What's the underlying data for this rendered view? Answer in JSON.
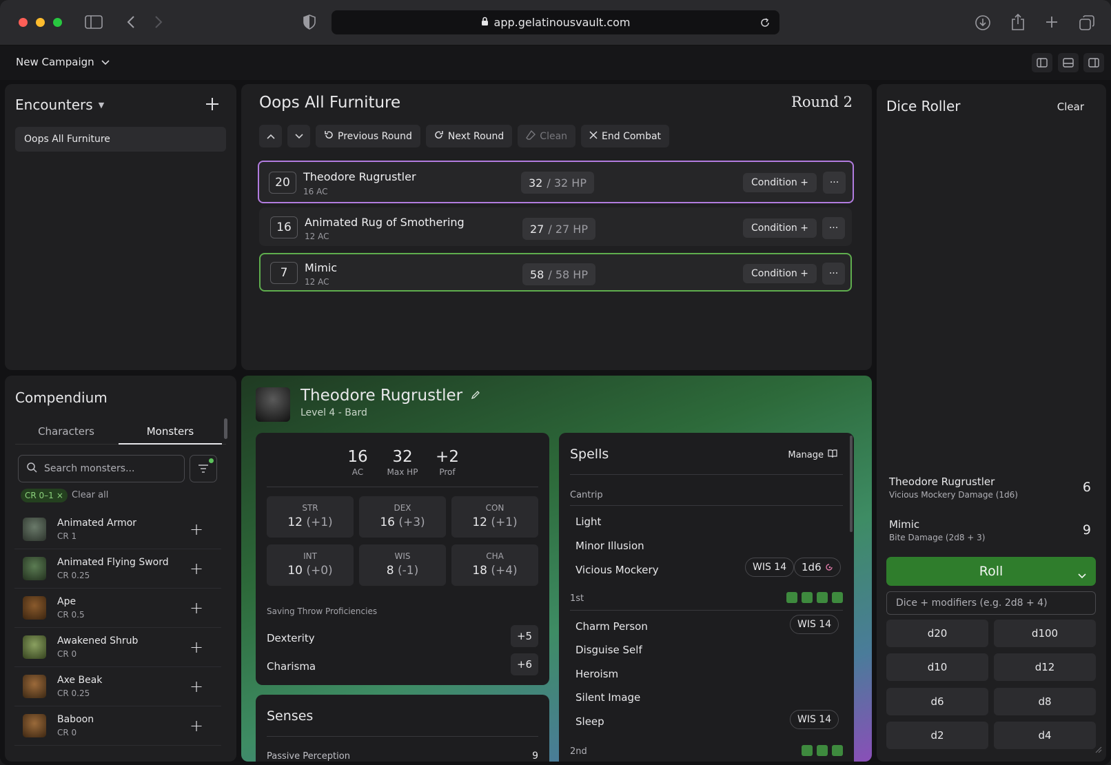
{
  "browser": {
    "url": "app.gelatinousvault.com"
  },
  "app": {
    "campaign": "New Campaign"
  },
  "encounters": {
    "title": "Encounters",
    "items": [
      "Oops All Furniture"
    ]
  },
  "tracker": {
    "title": "Oops All Furniture",
    "round": "Round 2",
    "buttons": {
      "prev": "Previous Round",
      "next": "Next Round",
      "clean": "Clean",
      "end": "End Combat"
    },
    "rows": [
      {
        "init": "20",
        "name": "Theodore Rugrustler",
        "ac": "16 AC",
        "hp_cur": "32",
        "hp_max": "/ 32 HP",
        "cond": "Condition +",
        "more": "···"
      },
      {
        "init": "16",
        "name": "Animated Rug of Smothering",
        "ac": "12 AC",
        "hp_cur": "27",
        "hp_max": "/ 27 HP",
        "cond": "Condition +",
        "more": "···"
      },
      {
        "init": "7",
        "name": "Mimic",
        "ac": "12 AC",
        "hp_cur": "58",
        "hp_max": "/ 58 HP",
        "cond": "Condition +",
        "more": "···"
      }
    ]
  },
  "compendium": {
    "title": "Compendium",
    "tabs": [
      "Characters",
      "Monsters"
    ],
    "search_placeholder": "Search monsters...",
    "filter_chip": "CR 0–1",
    "clear_all": "Clear all",
    "monsters": [
      {
        "name": "Animated Armor",
        "cr": "CR 1"
      },
      {
        "name": "Animated Flying Sword",
        "cr": "CR 0.25"
      },
      {
        "name": "Ape",
        "cr": "CR 0.5"
      },
      {
        "name": "Awakened Shrub",
        "cr": "CR 0"
      },
      {
        "name": "Axe Beak",
        "cr": "CR 0.25"
      },
      {
        "name": "Baboon",
        "cr": "CR 0"
      }
    ]
  },
  "sheet": {
    "name": "Theodore Rugrustler",
    "subtitle": "Level 4 - Bard",
    "stats": [
      {
        "value": "16",
        "label": "AC"
      },
      {
        "value": "32",
        "label": "Max HP"
      },
      {
        "value": "+2",
        "label": "Prof"
      }
    ],
    "abilities": [
      {
        "name": "STR",
        "score": "12",
        "mod": "(+1)"
      },
      {
        "name": "DEX",
        "score": "16",
        "mod": "(+3)"
      },
      {
        "name": "CON",
        "score": "12",
        "mod": "(+1)"
      },
      {
        "name": "INT",
        "score": "10",
        "mod": "(+0)"
      },
      {
        "name": "WIS",
        "score": "8",
        "mod": "(-1)"
      },
      {
        "name": "CHA",
        "score": "18",
        "mod": "(+4)"
      }
    ],
    "saving_title": "Saving Throw Proficiencies",
    "saves": [
      {
        "name": "Dexterity",
        "value": "+5"
      },
      {
        "name": "Charisma",
        "value": "+6"
      }
    ],
    "senses_title": "Senses",
    "passive_label": "Passive Perception",
    "passive_value": "9",
    "spells": {
      "title": "Spells",
      "manage": "Manage",
      "cantrip_label": "Cantrip",
      "cantrips": [
        "Light",
        "Minor Illusion",
        "Vicious Mockery"
      ],
      "vm_save": "WIS 14",
      "vm_dice": "1d6",
      "first_label": "1st",
      "first": [
        "Charm Person",
        "Disguise Self",
        "Heroism",
        "Silent Image",
        "Sleep"
      ],
      "charm_save": "WIS 14",
      "sleep_save": "WIS 14",
      "second_label": "2nd",
      "slots_first": 4,
      "slots_second": 3
    }
  },
  "dice": {
    "title": "Dice Roller",
    "clear": "Clear",
    "history": [
      {
        "who": "Theodore Rugrustler",
        "what": "Vicious Mockery Damage (1d6)",
        "result": "6"
      },
      {
        "who": "Mimic",
        "what": "Bite Damage (2d8 + 3)",
        "result": "9"
      }
    ],
    "roll": "Roll",
    "input_placeholder": "Dice + modifiers (e.g. 2d8 + 4)",
    "dice": [
      "d20",
      "d100",
      "d10",
      "d12",
      "d6",
      "d8",
      "d2",
      "d4"
    ]
  },
  "colors": {
    "active_border": "#b27ce0",
    "green_border": "#5fae4e",
    "roll_button": "#2f7d2c"
  }
}
